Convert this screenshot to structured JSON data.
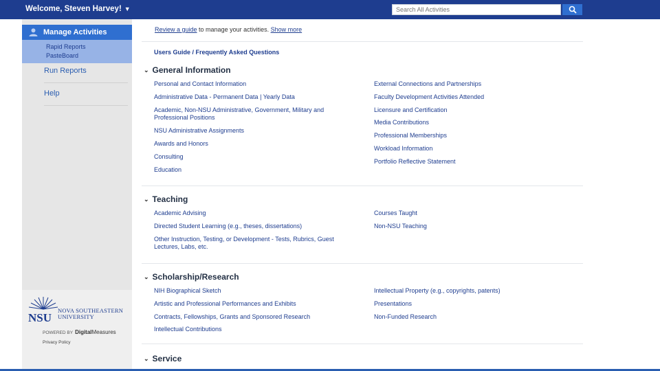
{
  "header": {
    "welcome": "Welcome, Steven Harvey!",
    "search_placeholder": "Search All Activities"
  },
  "sidebar": {
    "active": {
      "label": "Manage Activities",
      "subitems": [
        "Rapid Reports",
        "PasteBoard"
      ]
    },
    "items": [
      "Run Reports",
      "Help"
    ]
  },
  "branding": {
    "nsu_abbr": "NSU",
    "nsu_line1": "NOVA SOUTHEASTERN",
    "nsu_line2": "UNIVERSITY",
    "powered_by": "POWERED BY",
    "dm_prefix": "",
    "dm_bold": "Digital",
    "dm_suffix": "Measures",
    "privacy": "Privacy Policy"
  },
  "main": {
    "review_link": "Review a guide",
    "review_text": " to manage your activities. ",
    "show_more": "Show more",
    "guide_link": "Users Guide / Frequently Asked Questions",
    "sections": [
      {
        "title": "General Information",
        "left": [
          "Personal and Contact Information",
          "Administrative Data - Permanent Data | Yearly Data",
          "Academic, Non-NSU Administrative, Government, Military and Professional Positions",
          "NSU Administrative Assignments",
          "Awards and Honors",
          "Consulting",
          "Education"
        ],
        "right": [
          "External Connections and Partnerships",
          "Faculty Development Activities Attended",
          "Licensure and Certification",
          "Media Contributions",
          "Professional Memberships",
          "Workload Information",
          "Portfolio Reflective Statement"
        ]
      },
      {
        "title": "Teaching",
        "left": [
          "Academic Advising",
          "Directed Student Learning (e.g., theses, dissertations)",
          "Other Instruction, Testing, or Development - Tests, Rubrics, Guest Lectures, Labs, etc."
        ],
        "right": [
          "Courses Taught",
          "Non-NSU Teaching"
        ]
      },
      {
        "title": "Scholarship/Research",
        "left": [
          "NIH Biographical Sketch",
          "Artistic and Professional Performances and Exhibits",
          "Contracts, Fellowships, Grants and Sponsored Research",
          "Intellectual Contributions"
        ],
        "right": [
          "Intellectual Property (e.g., copyrights, patents)",
          "Presentations",
          "Non-Funded Research"
        ]
      },
      {
        "title": "Service"
      }
    ]
  },
  "colors": {
    "header_bg": "#1e3d8f",
    "active_nav": "#2f6fd0",
    "active_sub_bg": "#97b3e6",
    "link": "#1e3d8f"
  }
}
